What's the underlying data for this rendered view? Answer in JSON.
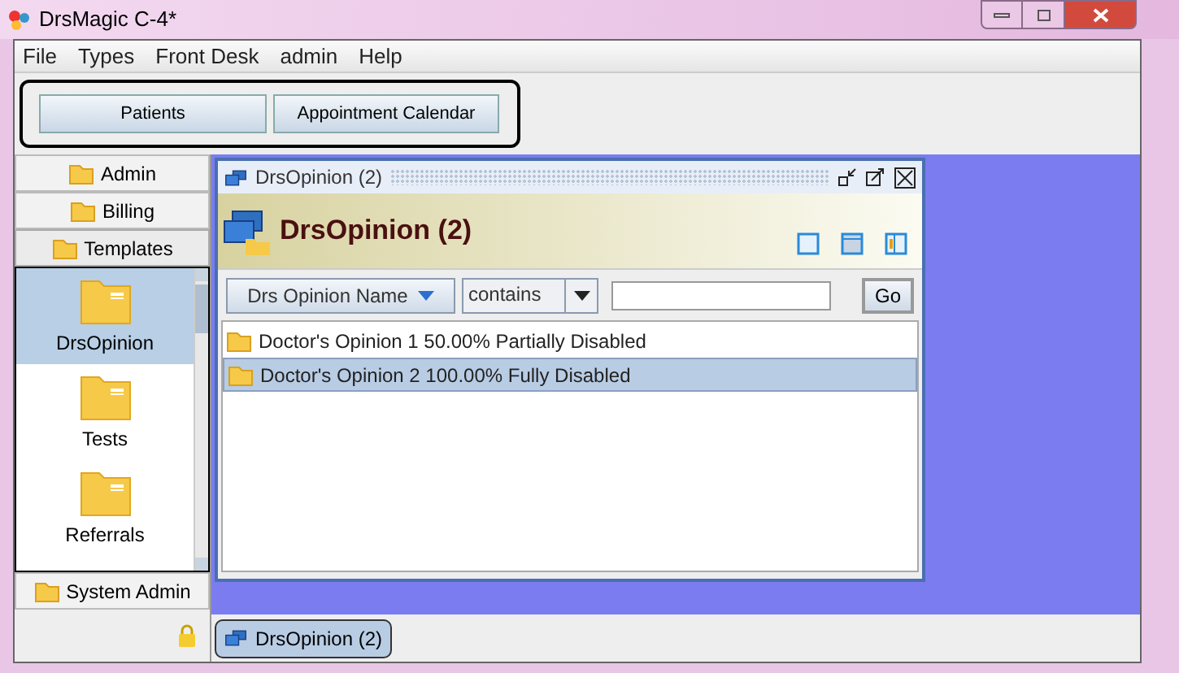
{
  "window": {
    "title": "DrsMagic C-4*"
  },
  "menu": [
    "File",
    "Types",
    "Front Desk",
    "admin",
    "Help"
  ],
  "toolbar": [
    "Patients",
    "Appointment Calendar"
  ],
  "sidebar": [
    {
      "label": "Admin",
      "expanded": false
    },
    {
      "label": "Billing",
      "expanded": false
    },
    {
      "label": "Templates",
      "expanded": true,
      "items": [
        {
          "label": "DrsOpinion",
          "selected": true
        },
        {
          "label": "Tests",
          "selected": false
        },
        {
          "label": "Referrals",
          "selected": false
        }
      ]
    },
    {
      "label": "System Admin",
      "expanded": false
    }
  ],
  "internal_frame": {
    "title": "DrsOpinion (2)",
    "heading": "DrsOpinion (2)",
    "filter": {
      "field": "Drs Opinion Name",
      "operator": "contains",
      "button": "Go"
    },
    "rows": [
      {
        "text": "Doctor's Opinion 1 50.00% Partially Disabled",
        "selected": false
      },
      {
        "text": "Doctor's Opinion 2 100.00% Fully Disabled",
        "selected": true
      }
    ]
  },
  "taskbar": [
    {
      "label": "DrsOpinion (2)"
    }
  ]
}
